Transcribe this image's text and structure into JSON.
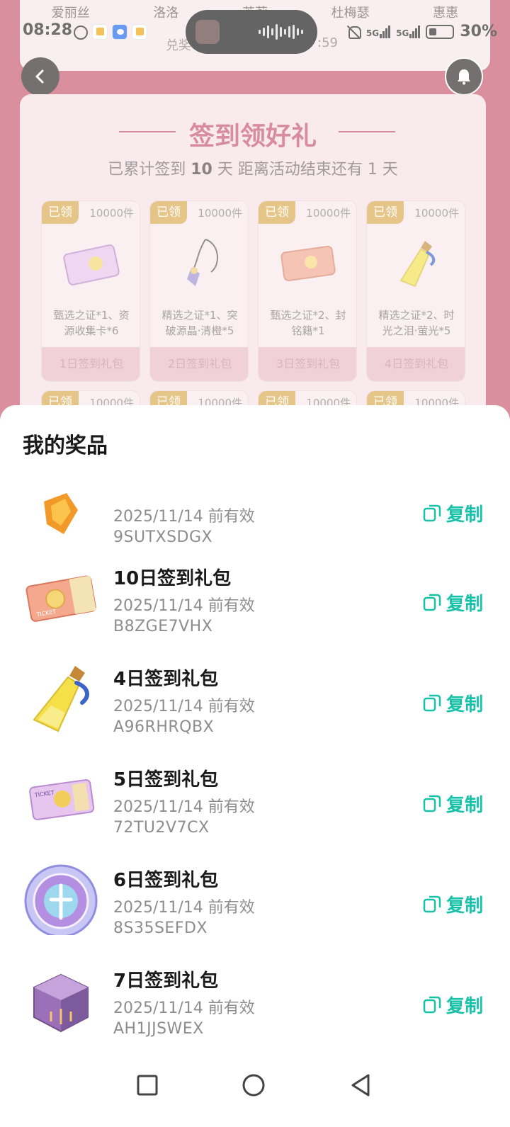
{
  "status_bar": {
    "time": "08:28",
    "signal_1": "5G",
    "signal_2": "5G",
    "battery": "30%"
  },
  "background": {
    "name_tabs": [
      "爱丽丝",
      "洛洛",
      "茉莉",
      "杜梅瑟",
      "惠惠"
    ],
    "redeem_text": "兑奖",
    "redeem_time": ":59",
    "signin_title": "签到领好礼",
    "signin_sub_prefix": "已累计签到",
    "signin_days": "10",
    "signin_sub_suffix": "天  距离活动结束还有 1 天",
    "gifts": [
      {
        "badge": "已领",
        "count": "10000件",
        "desc": "甄选之证*1、资源收集卡*6",
        "foot": "1日签到礼包",
        "icon": "ticket-card-icon"
      },
      {
        "badge": "已领",
        "count": "10000件",
        "desc": "精选之证*1、突破源晶·清橙*5",
        "foot": "2日签到礼包",
        "icon": "charm-pendant-icon"
      },
      {
        "badge": "已领",
        "count": "10000件",
        "desc": "甄选之证*2、封铭籍*1",
        "foot": "3日签到礼包",
        "icon": "ticket-card-icon"
      },
      {
        "badge": "已领",
        "count": "10000件",
        "desc": "精选之证*2、时光之泪·萤光*5",
        "foot": "4日签到礼包",
        "icon": "potion-bottle-icon"
      }
    ],
    "row2": [
      {
        "badge": "已领",
        "count": "10000件"
      },
      {
        "badge": "已领",
        "count": "10000件"
      },
      {
        "badge": "已领",
        "count": "10000件"
      },
      {
        "badge": "已领",
        "count": "10000件"
      }
    ]
  },
  "sheet": {
    "title": "我的奖品",
    "items": [
      {
        "name": "",
        "expiry": "2025/11/14 前有效",
        "code": "9SUTXSDGX",
        "copy_label": "复制",
        "icon": "crystal-gem-icon"
      },
      {
        "name": "10日签到礼包",
        "expiry": "2025/11/14 前有效",
        "code": "B8ZGE7VHX",
        "copy_label": "复制",
        "icon": "ticket-card-icon"
      },
      {
        "name": "4日签到礼包",
        "expiry": "2025/11/14 前有效",
        "code": "A96RHRQBX",
        "copy_label": "复制",
        "icon": "potion-bottle-icon"
      },
      {
        "name": "5日签到礼包",
        "expiry": "2025/11/14 前有效",
        "code": "72TU2V7CX",
        "copy_label": "复制",
        "icon": "ticket-card-icon"
      },
      {
        "name": "6日签到礼包",
        "expiry": "2025/11/14 前有效",
        "code": "8S35SEFDX",
        "copy_label": "复制",
        "icon": "emblem-disc-icon"
      },
      {
        "name": "7日签到礼包",
        "expiry": "2025/11/14 前有效",
        "code": "AH1JJSWEX",
        "copy_label": "复制",
        "icon": "purple-cube-icon"
      }
    ]
  },
  "colors": {
    "accent_copy": "#17c2a8",
    "panel_title": "#c4506a",
    "badge": "#d9a74a"
  }
}
